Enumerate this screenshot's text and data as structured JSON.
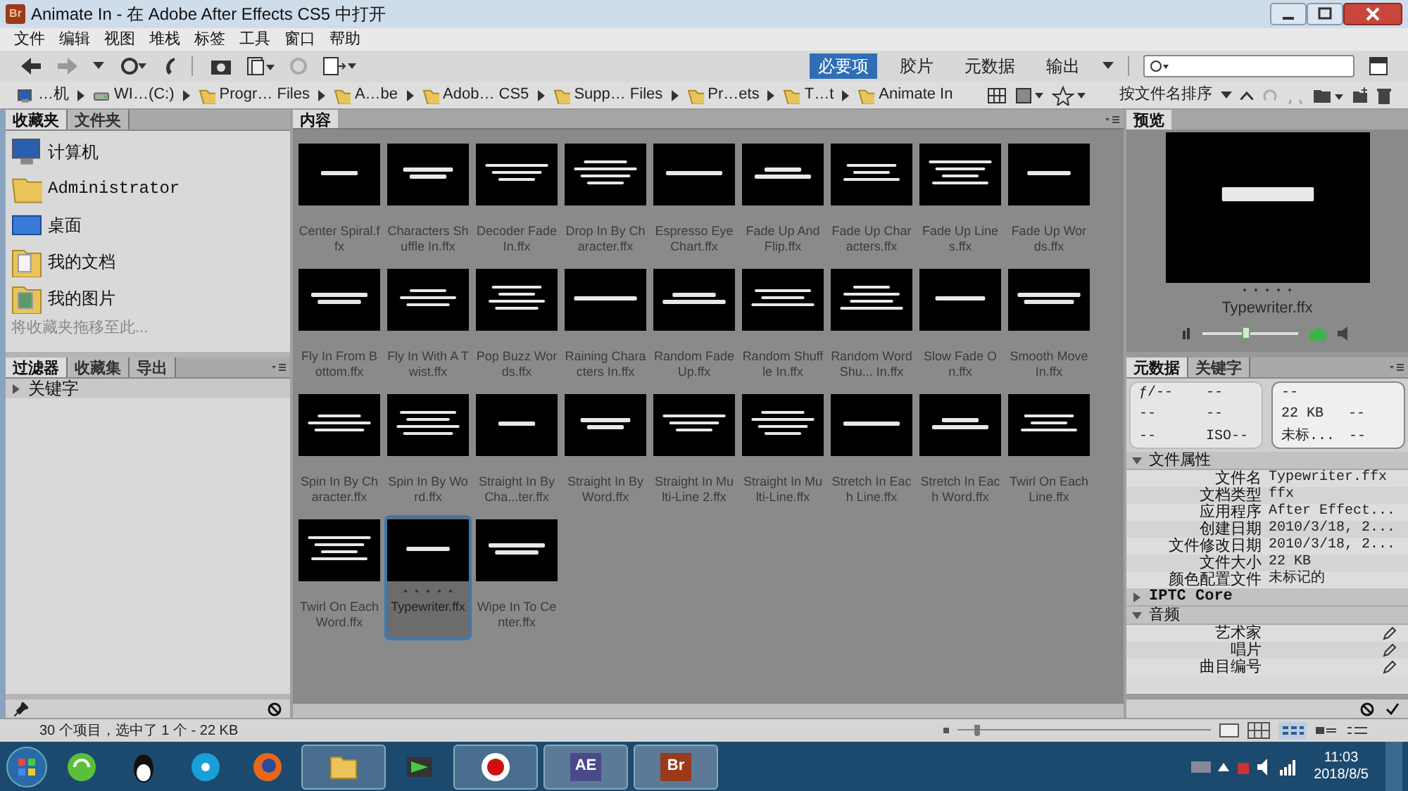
{
  "window": {
    "title": "Animate In - 在 Adobe After Effects CS5 中打开",
    "app_badge": "Br"
  },
  "menu": [
    "文件",
    "编辑",
    "视图",
    "堆栈",
    "标签",
    "工具",
    "窗口",
    "帮助"
  ],
  "workspaces": [
    {
      "label": "必要项",
      "selected": true
    },
    {
      "label": "胶片",
      "selected": false
    },
    {
      "label": "元数据",
      "selected": false
    },
    {
      "label": "输出",
      "selected": false
    }
  ],
  "path": [
    {
      "label": "…机",
      "kind": "computer"
    },
    {
      "label": "WI…(C:)",
      "kind": "drive"
    },
    {
      "label": "Progr… Files",
      "kind": "folder"
    },
    {
      "label": "A…be",
      "kind": "folder"
    },
    {
      "label": "Adob… CS5",
      "kind": "folder"
    },
    {
      "label": "Supp… Files",
      "kind": "folder"
    },
    {
      "label": "Pr…ets",
      "kind": "folder"
    },
    {
      "label": "T…t",
      "kind": "folder"
    },
    {
      "label": "Animate In",
      "kind": "folder"
    }
  ],
  "sort_label": "按文件名排序",
  "favorites_tabs": [
    {
      "label": "收藏夹",
      "selected": true
    },
    {
      "label": "文件夹",
      "selected": false
    }
  ],
  "favorites": [
    {
      "label": "计算机",
      "kind": "computer"
    },
    {
      "label": "Administrator",
      "kind": "folder"
    },
    {
      "label": "桌面",
      "kind": "desktop"
    },
    {
      "label": "我的文档",
      "kind": "documents"
    },
    {
      "label": "我的图片",
      "kind": "pictures"
    }
  ],
  "favorites_hint": "将收藏夹拖移至此...",
  "filter_tabs": [
    {
      "label": "过滤器",
      "selected": true
    },
    {
      "label": "收藏集",
      "selected": false
    },
    {
      "label": "导出",
      "selected": false
    }
  ],
  "filter_sections": [
    {
      "label": "关键字",
      "expanded": false
    }
  ],
  "content_tab": "内容",
  "items": [
    {
      "name": "Center Spiral.ffx",
      "selected": false
    },
    {
      "name": "Characters Shuffle In.ffx",
      "selected": false
    },
    {
      "name": "Decoder Fade In.ffx",
      "selected": false
    },
    {
      "name": "Drop In By Character.ffx",
      "selected": false
    },
    {
      "name": "Espresso Eye Chart.ffx",
      "selected": false
    },
    {
      "name": "Fade Up And Flip.ffx",
      "selected": false
    },
    {
      "name": "Fade Up Characters.ffx",
      "selected": false
    },
    {
      "name": "Fade Up Lines.ffx",
      "selected": false
    },
    {
      "name": "Fade Up Words.ffx",
      "selected": false
    },
    {
      "name": "Fly In From Bottom.ffx",
      "selected": false
    },
    {
      "name": "Fly In With A Twist.ffx",
      "selected": false
    },
    {
      "name": "Pop Buzz Words.ffx",
      "selected": false
    },
    {
      "name": "Raining Characters In.ffx",
      "selected": false
    },
    {
      "name": "Random Fade Up.ffx",
      "selected": false
    },
    {
      "name": "Random Shuffle In.ffx",
      "selected": false
    },
    {
      "name": "Random Word Shu... In.ffx",
      "selected": false
    },
    {
      "name": "Slow Fade On.ffx",
      "selected": false
    },
    {
      "name": "Smooth Move In.ffx",
      "selected": false
    },
    {
      "name": "Spin In By Character.ffx",
      "selected": false
    },
    {
      "name": "Spin In By Word.ffx",
      "selected": false
    },
    {
      "name": "Straight In By Cha...ter.ffx",
      "selected": false
    },
    {
      "name": "Straight In By Word.ffx",
      "selected": false
    },
    {
      "name": "Straight In Multi-Line 2.ffx",
      "selected": false
    },
    {
      "name": "Straight In Multi-Line.ffx",
      "selected": false
    },
    {
      "name": "Stretch In Each Line.ffx",
      "selected": false
    },
    {
      "name": "Stretch In Each Word.ffx",
      "selected": false
    },
    {
      "name": "Twirl On Each Line.ffx",
      "selected": false
    },
    {
      "name": "Twirl On Each Word.ffx",
      "selected": false
    },
    {
      "name": "Typewriter.ffx",
      "selected": true,
      "stars": 0
    },
    {
      "name": "Wipe In To Center.ffx",
      "selected": false
    }
  ],
  "preview": {
    "tab": "预览",
    "filename": "Typewriter.ffx",
    "stars": 0,
    "level": 0.45
  },
  "metadata_tabs": [
    {
      "label": "元数据",
      "selected": true
    },
    {
      "label": "关键字",
      "selected": false
    }
  ],
  "summary_left": [
    [
      "ƒ/--",
      "--"
    ],
    [
      "--",
      "--"
    ],
    [
      "--",
      "ISO--"
    ]
  ],
  "summary_right": [
    [
      "--"
    ],
    [
      "22 KB",
      "--"
    ],
    [
      "未标...",
      "--"
    ]
  ],
  "sections": [
    {
      "label": "文件属性",
      "expanded": true,
      "rows": [
        {
          "label": "文件名",
          "value": "Typewriter.ffx"
        },
        {
          "label": "文档类型",
          "value": "ffx"
        },
        {
          "label": "应用程序",
          "value": "After Effect..."
        },
        {
          "label": "创建日期",
          "value": "2010/3/18, 2..."
        },
        {
          "label": "文件修改日期",
          "value": "2010/3/18, 2..."
        },
        {
          "label": "文件大小",
          "value": "22 KB"
        },
        {
          "label": "颜色配置文件",
          "value": "未标记的"
        }
      ]
    },
    {
      "label": "IPTC Core",
      "expanded": false
    },
    {
      "label": "音频",
      "expanded": true,
      "rows": [
        {
          "label": "艺术家",
          "editable": true
        },
        {
          "label": "唱片",
          "editable": true
        },
        {
          "label": "曲目编号",
          "editable": true
        }
      ]
    }
  ],
  "status": "30 个项目，选中了 1 个 - 22 KB",
  "zoom_slider": {
    "level": 0.08
  },
  "taskbar": {
    "apps": [
      {
        "kind": "sync"
      },
      {
        "kind": "penguin"
      },
      {
        "kind": "reel"
      },
      {
        "kind": "browser"
      },
      {
        "kind": "folder"
      },
      {
        "kind": "player"
      },
      {
        "kind": "record"
      },
      {
        "kind": "badge",
        "label": "AE",
        "color": "#4a4a8a"
      },
      {
        "kind": "badge",
        "label": "Br",
        "color": "#9a3a1a"
      }
    ],
    "time": "11:03",
    "date": "2018/8/5"
  }
}
